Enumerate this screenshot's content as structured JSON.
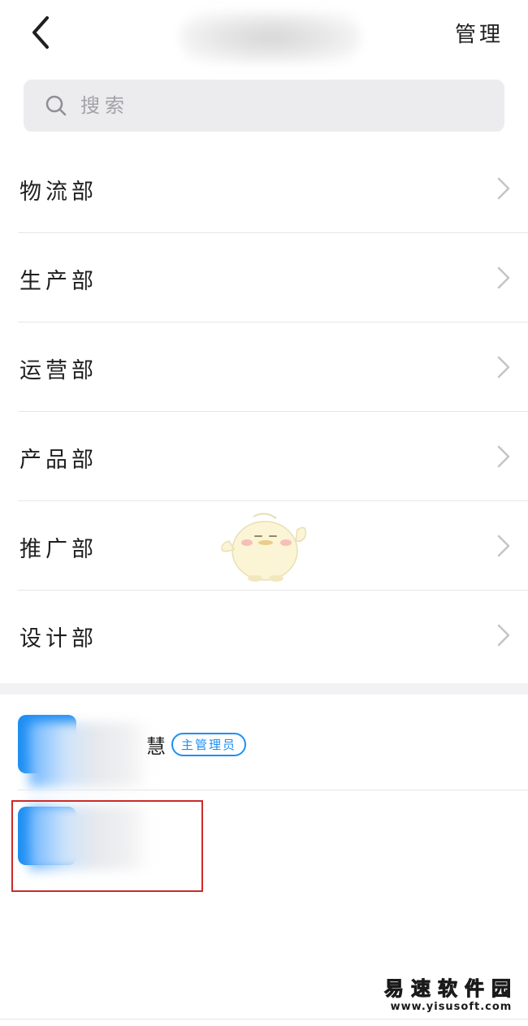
{
  "header": {
    "manage_label": "管理"
  },
  "search": {
    "placeholder": "搜索"
  },
  "departments": [
    {
      "label": "物流部"
    },
    {
      "label": "生产部"
    },
    {
      "label": "运营部"
    },
    {
      "label": "产品部"
    },
    {
      "label": "推广部"
    },
    {
      "label": "设计部"
    }
  ],
  "members": [
    {
      "name_tail": "慧",
      "badge": "主管理员"
    },
    {}
  ],
  "watermark": {
    "brand": "易速软件园",
    "url": "www.yisusoft.com",
    "brand_color": "#ffc400"
  },
  "colors": {
    "accent": "#1e8ff3",
    "highlight": "#cc2a2a"
  }
}
